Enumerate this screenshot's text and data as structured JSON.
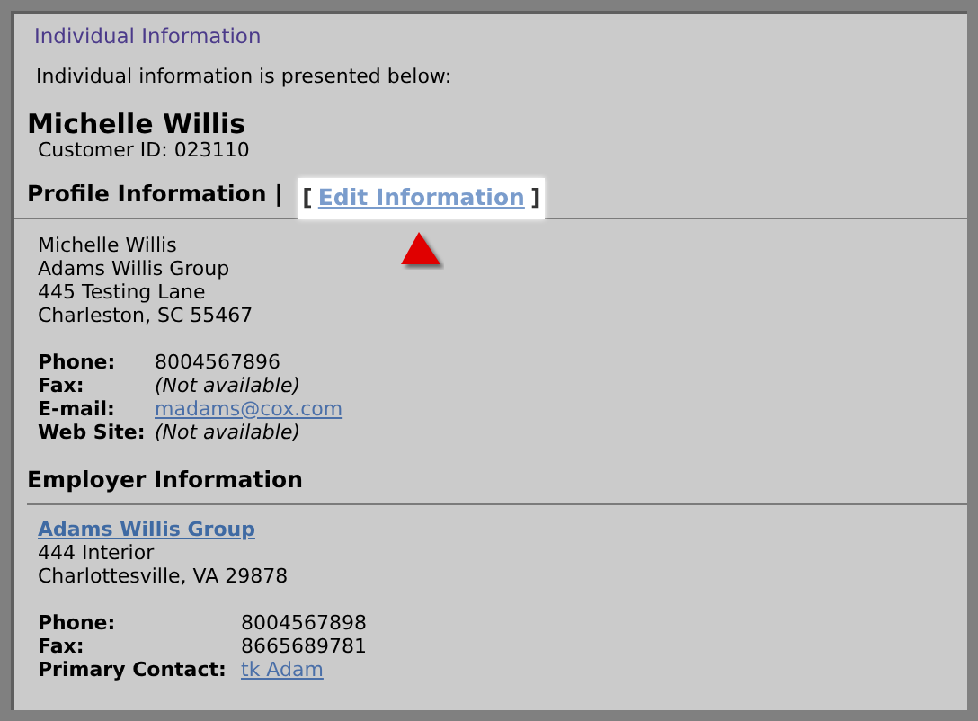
{
  "panel": {
    "title": "Individual Information",
    "intro": "Individual information is presented below:"
  },
  "customer": {
    "name": "Michelle Willis",
    "id_line": "Customer ID: 023110"
  },
  "profile": {
    "heading": "Profile Information |",
    "edit_open": "[",
    "edit_link": "Edit Information",
    "edit_close": "]",
    "address": [
      "Michelle Willis",
      "Adams Willis Group",
      "445 Testing Lane",
      "Charleston, SC 55467"
    ],
    "fields": [
      {
        "label": "Phone:",
        "value": "8004567896",
        "kind": "text"
      },
      {
        "label": "Fax:",
        "value": "(Not available)",
        "kind": "unavailable"
      },
      {
        "label": "E-mail:",
        "value": "madams@cox.com",
        "kind": "link"
      },
      {
        "label": "Web Site:",
        "value": "(Not available)",
        "kind": "unavailable"
      }
    ]
  },
  "employer": {
    "heading": "Employer Information",
    "company_link": "Adams Willis Group",
    "address": [
      "444 Interior",
      "Charlottesville, VA 29878"
    ],
    "fields": [
      {
        "label": "Phone:",
        "value": "8004567898",
        "kind": "text"
      },
      {
        "label": "Fax:",
        "value": "8665689781",
        "kind": "text"
      },
      {
        "label": "Primary Contact:",
        "value": "tk Adam",
        "kind": "link"
      }
    ]
  }
}
